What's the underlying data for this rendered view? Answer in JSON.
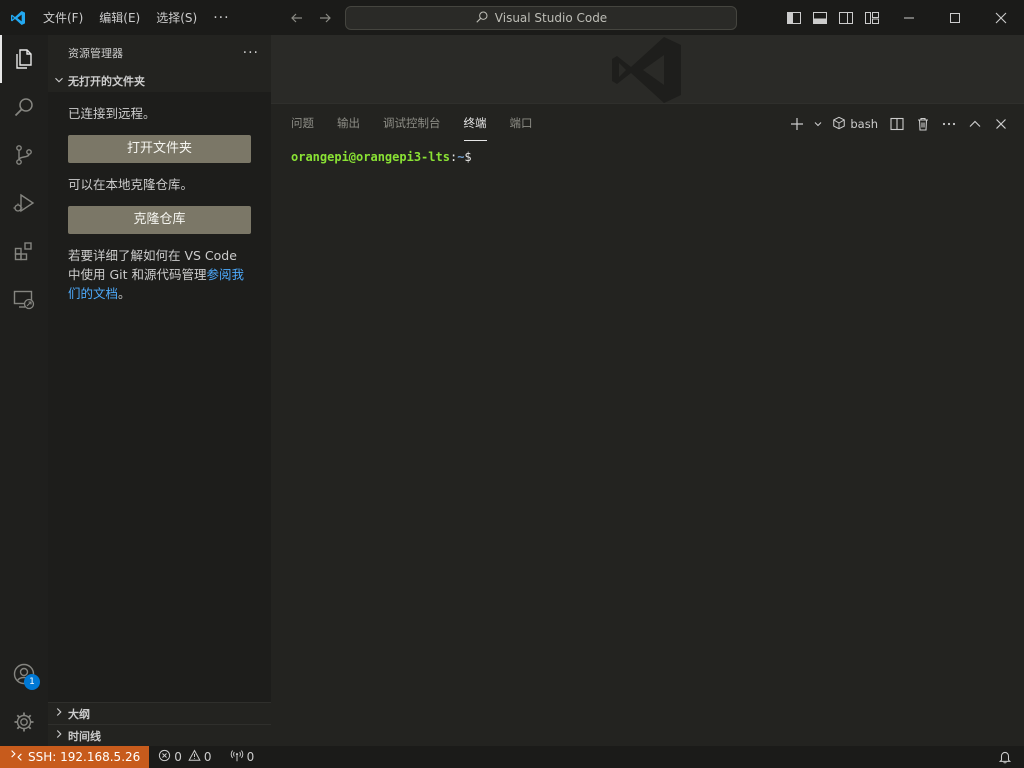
{
  "titlebar": {
    "menu": [
      "文件(F)",
      "编辑(E)",
      "选择(S)"
    ],
    "more": "···",
    "search_text": "Visual Studio Code"
  },
  "activitybar": {
    "items": [
      "explorer",
      "search",
      "source-control",
      "run-and-debug",
      "extensions",
      "remote-explorer"
    ],
    "accounts_badge": "1"
  },
  "sidebar": {
    "title": "资源管理器",
    "more": "···",
    "section_title": "无打开的文件夹",
    "connected_text": "已连接到远程。",
    "open_folder_button": "打开文件夹",
    "clone_hint": "可以在本地克隆仓库。",
    "clone_button": "克隆仓库",
    "docs_text_1": "若要详细了解如何在 VS Code 中使用 Git 和源代码管理",
    "docs_link": "参阅我们的文档",
    "docs_text_end": "。",
    "outline": "大纲",
    "timeline": "时间线"
  },
  "panel": {
    "tabs": [
      "问题",
      "输出",
      "调试控制台",
      "终端",
      "端口"
    ],
    "active_tab": "终端",
    "shell": "bash"
  },
  "terminal": {
    "user_host": "orangepi@orangepi3-lts",
    "separator": ":",
    "path": "~",
    "prompt": "$"
  },
  "statusbar": {
    "remote": "SSH: 192.168.5.26",
    "errors": "0",
    "warnings": "0",
    "ports": "0"
  },
  "colors": {
    "accent": "#0078d4",
    "remote_bg": "#c75b1c",
    "button_bg": "#7b7767",
    "link": "#4daafc",
    "terminal_user": "#8ae234",
    "terminal_path": "#729fcf"
  }
}
